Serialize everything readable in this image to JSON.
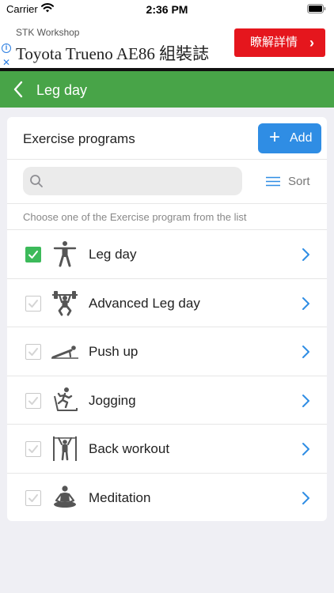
{
  "status_bar": {
    "carrier": "Carrier",
    "time": "2:36 PM"
  },
  "ad": {
    "source": "STK Workshop",
    "headline": "Toyota Trueno AE86 組裝誌",
    "cta_label": "瞭解詳情",
    "cta_color": "#e5161d",
    "info_icon": "info-icon",
    "close_icon": "close-icon"
  },
  "nav": {
    "title": "Leg day",
    "bar_color": "#48a448"
  },
  "card": {
    "title": "Exercise programs",
    "add_label": "Add",
    "search_placeholder": "",
    "sort_label": "Sort",
    "hint": "Choose one of the Exercise program from the list"
  },
  "programs": [
    {
      "name": "Leg day",
      "checked": true,
      "icon": "standing-figure-icon"
    },
    {
      "name": "Advanced Leg day",
      "checked": false,
      "icon": "weightlifter-icon"
    },
    {
      "name": "Push up",
      "checked": false,
      "icon": "pushup-icon"
    },
    {
      "name": "Jogging",
      "checked": false,
      "icon": "treadmill-runner-icon"
    },
    {
      "name": "Back workout",
      "checked": false,
      "icon": "pullup-bar-icon"
    },
    {
      "name": "Meditation",
      "checked": false,
      "icon": "meditation-icon"
    }
  ],
  "colors": {
    "accent_blue": "#2f8de4",
    "check_green": "#3cba5a"
  }
}
